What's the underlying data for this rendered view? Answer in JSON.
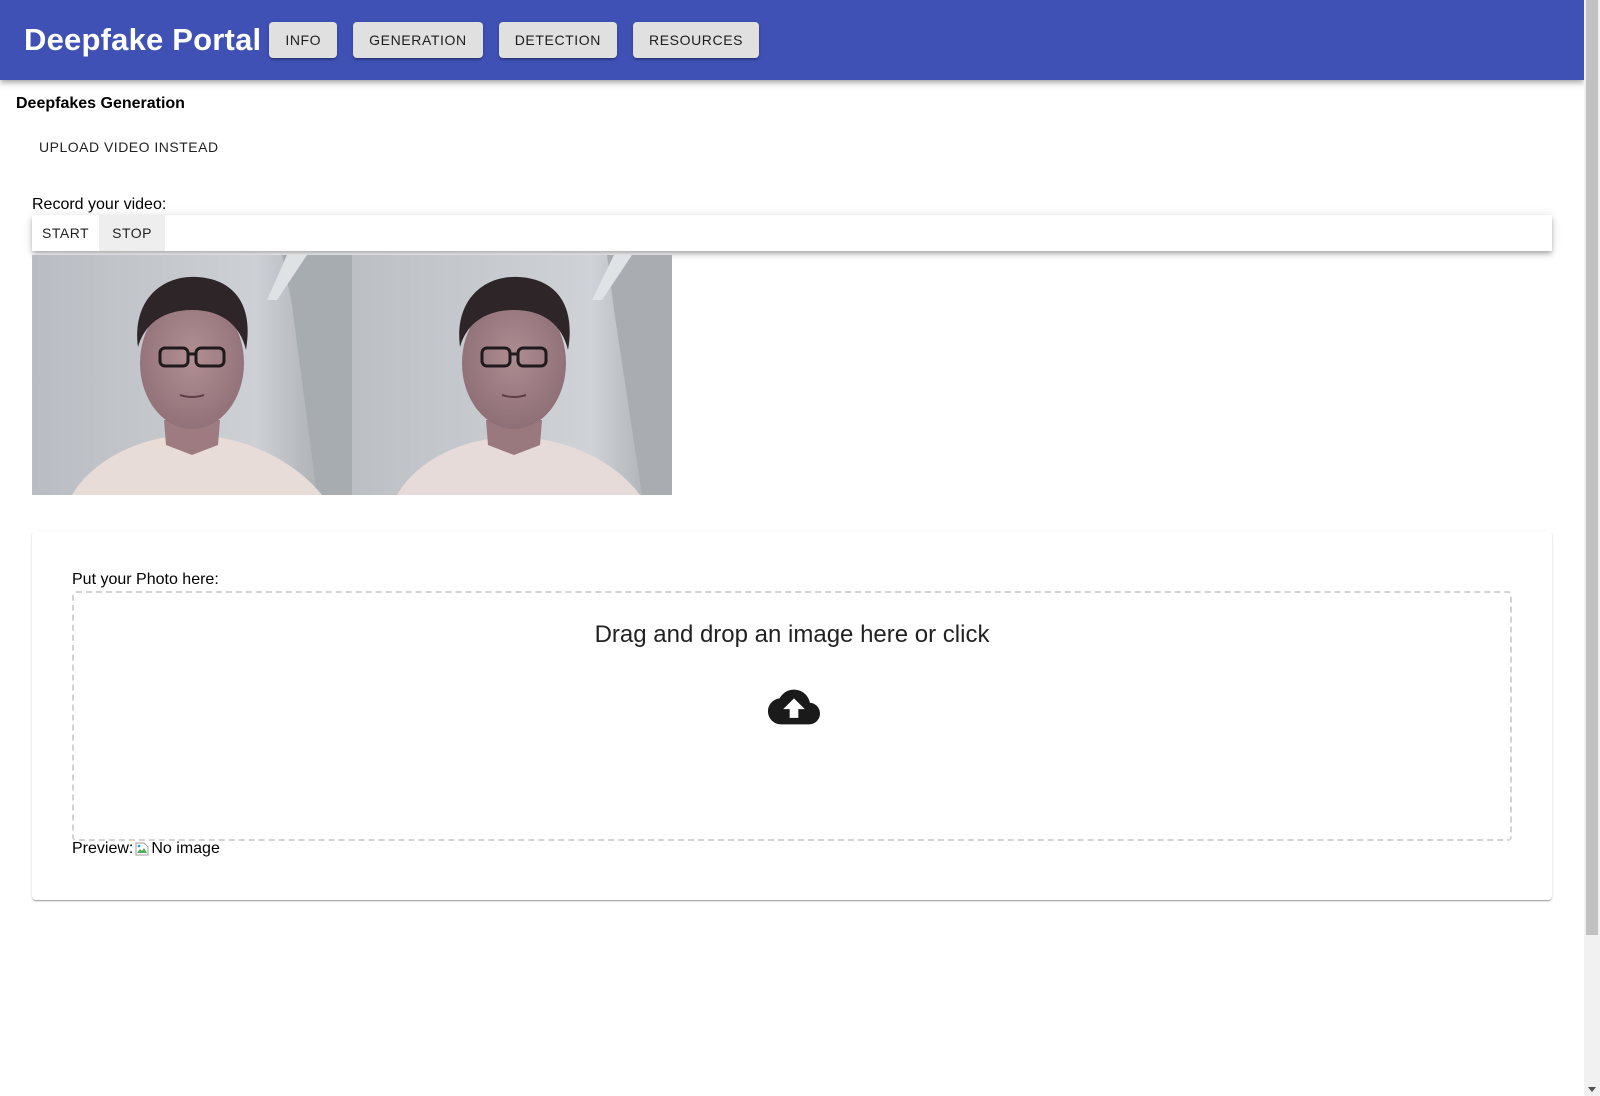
{
  "header": {
    "title": "Deepfake Portal",
    "nav": [
      {
        "label": "INFO"
      },
      {
        "label": "GENERATION"
      },
      {
        "label": "DETECTION"
      },
      {
        "label": "RESOURCES"
      }
    ],
    "bar_color": "#3f51b5"
  },
  "main": {
    "heading": "Deepfakes Generation",
    "upload_video_button": "UPLOAD VIDEO INSTEAD",
    "record": {
      "label": "Record your video:",
      "start_label": "START",
      "stop_label": "STOP"
    },
    "photo": {
      "label": "Put your Photo here:",
      "dropzone_text": "Drag and drop an image here or click",
      "upload_icon": "cloud-upload-icon",
      "preview_label": "Preview:",
      "preview_alt": "No image"
    }
  }
}
